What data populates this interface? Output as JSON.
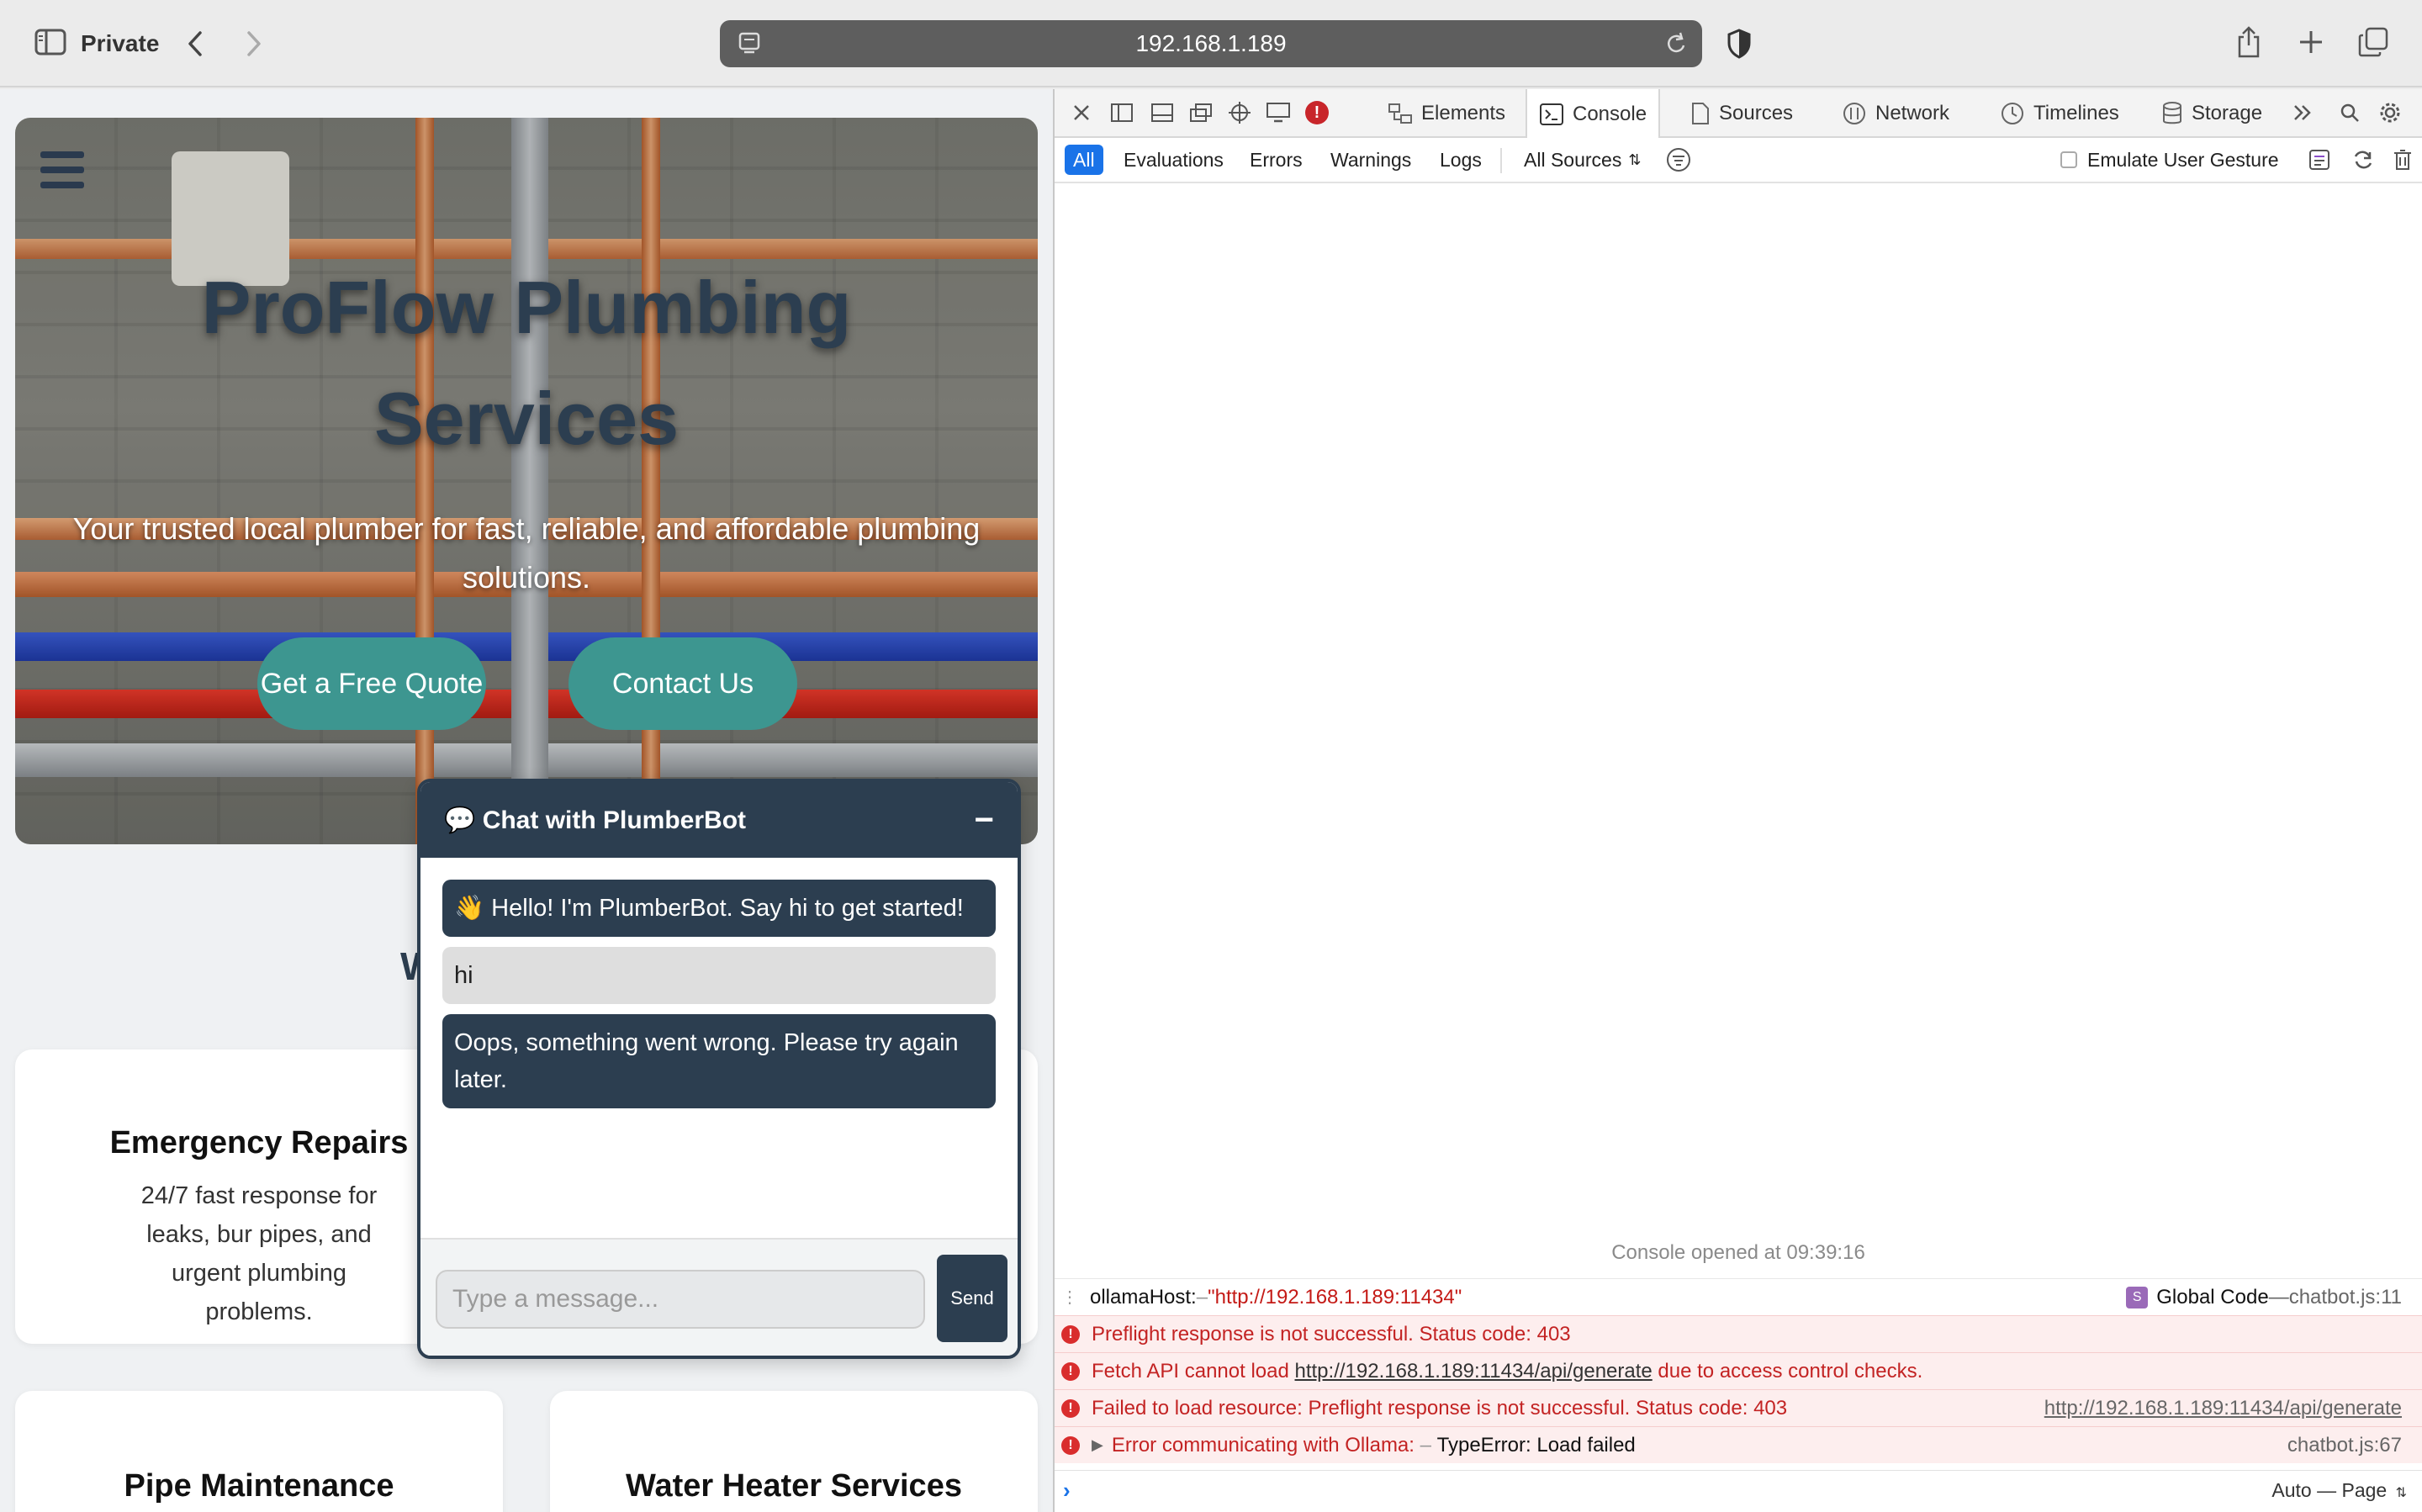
{
  "browser": {
    "private_label": "Private",
    "url": "192.168.1.189"
  },
  "site": {
    "hero_title": "ProFlow Plumbing Services",
    "hero_subtitle": "Your trusted local plumber for fast, reliable, and affordable plumbing solutions.",
    "btn_quote": "Get a Free Quote",
    "btn_contact": "Contact Us",
    "section_heading_visible": "W",
    "cards": [
      {
        "title": "Emergency Repairs",
        "desc": "24/7 fast response for leaks, bur pipes, and urgent plumbing problems."
      },
      {
        "title": "Pipe Maintenance"
      },
      {
        "title": "Water Heater Services"
      }
    ]
  },
  "chat": {
    "header": "💬 Chat with PlumberBot",
    "minimize": "−",
    "messages": [
      {
        "from": "bot",
        "text": "👋 Hello! I'm PlumberBot. Say hi to get started!"
      },
      {
        "from": "user",
        "text": "hi"
      },
      {
        "from": "bot",
        "text": "Oops, something went wrong. Please try again later."
      }
    ],
    "input_placeholder": "Type a message...",
    "send_label": "Send"
  },
  "devtools": {
    "tabs": [
      "Elements",
      "Console",
      "Sources",
      "Network",
      "Timelines",
      "Storage"
    ],
    "active_tab": "Console",
    "filters": [
      "All",
      "Evaluations",
      "Errors",
      "Warnings",
      "Logs"
    ],
    "sources_select": "All Sources",
    "emulate_label": "Emulate User Gesture",
    "console_opened": "Console opened at 09:39:16",
    "logs": [
      {
        "type": "log",
        "key": "ollamaHost:",
        "sep": " – ",
        "value": "\"http://192.168.1.189:11434\"",
        "src_badge": "S",
        "src_label": "Global Code",
        "src_sep": " — ",
        "src_file": "chatbot.js:11"
      },
      {
        "type": "error",
        "text": "Preflight response is not successful. Status code: 403"
      },
      {
        "type": "error",
        "text_before": "Fetch API cannot load ",
        "link": "http://192.168.1.189:11434/api/generate",
        "text_after": " due to access control checks."
      },
      {
        "type": "error",
        "text": "Failed to load resource: Preflight response is not successful. Status code: 403",
        "right_link": "http://192.168.1.189:11434/api/generate"
      },
      {
        "type": "error",
        "text": "Error communicating with Ollama:",
        "sep": " – ",
        "detail": "TypeError: Load failed",
        "src_file": "chatbot.js:67"
      }
    ],
    "context_select": "Auto — Page"
  },
  "colors": {
    "chat_dark": "#2c3e50",
    "hero_button": "#3d9690",
    "devtools_accent": "#1a73e8",
    "error_red": "#c32323"
  }
}
